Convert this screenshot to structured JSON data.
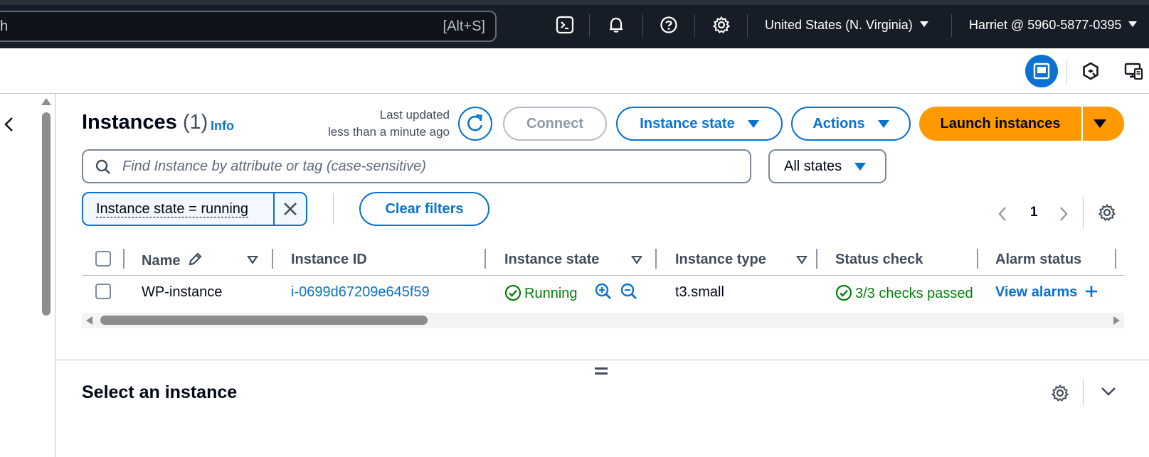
{
  "topnav": {
    "search_fragment": "h",
    "search_shortcut": "[Alt+S]",
    "region": "United States (N. Virginia)",
    "account": "Harriet @ 5960-5877-0395"
  },
  "instances": {
    "title": "Instances",
    "count": "(1)",
    "info_label": "Info",
    "last_updated_line1": "Last updated",
    "last_updated_line2": "less than a minute ago",
    "connect_label": "Connect",
    "instance_state_label": "Instance state",
    "actions_label": "Actions",
    "launch_label": "Launch instances",
    "find_placeholder": "Find Instance by attribute or tag (case-sensitive)",
    "states_selected": "All states",
    "filter_token": "Instance state = running",
    "clear_filters_label": "Clear filters",
    "page_number": "1"
  },
  "table": {
    "columns": [
      "Name",
      "Instance ID",
      "Instance state",
      "Instance type",
      "Status check",
      "Alarm status"
    ],
    "rows": [
      {
        "name": "WP-instance",
        "instance_id": "i-0699d67209e645f59",
        "state": "Running",
        "type": "t3.small",
        "status_check": "3/3 checks passed",
        "alarm": "View alarms"
      }
    ]
  },
  "split_panel": {
    "title": "Select an instance"
  },
  "colors": {
    "accent": "#0972d3",
    "launch": "#ff9900",
    "success": "#037f0c",
    "nav_bg": "#161d26"
  }
}
